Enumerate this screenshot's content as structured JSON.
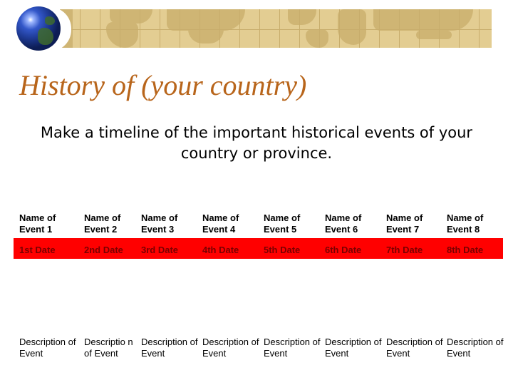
{
  "title": "History of (your country)",
  "subtitle": "Make a timeline of the important historical events of your country or province.",
  "colors": {
    "title": "#b8651b",
    "date_band": "#ff0000",
    "date_text": "#7a0000",
    "banner": "#e3cd92"
  },
  "timeline": {
    "events": [
      {
        "name": "Name of Event 1",
        "date": "1st Date",
        "description": "Description of Event"
      },
      {
        "name": "Name of Event 2",
        "date": "2nd Date",
        "description": "Descriptio n of Event"
      },
      {
        "name": "Name of Event 3",
        "date": "3rd Date",
        "description": "Description of Event"
      },
      {
        "name": "Name of Event 4",
        "date": "4th Date",
        "description": "Description of Event"
      },
      {
        "name": "Name of Event 5",
        "date": "5th Date",
        "description": "Description of Event"
      },
      {
        "name": "Name of Event 6",
        "date": "6th Date",
        "description": "Description of Event"
      },
      {
        "name": "Name of Event 7",
        "date": "7th Date",
        "description": "Description of Event"
      },
      {
        "name": "Name of Event 8",
        "date": "8th Date",
        "description": "Description of Event"
      }
    ]
  }
}
